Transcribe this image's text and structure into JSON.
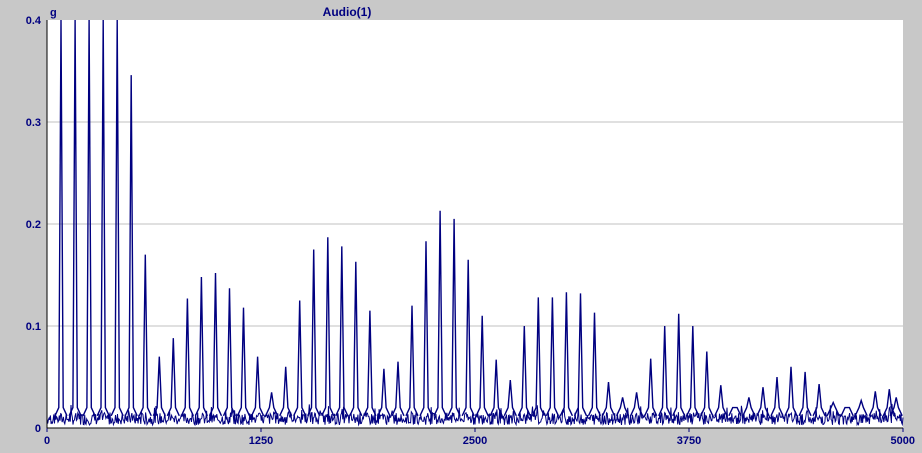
{
  "chart_data": {
    "type": "line",
    "title": "Audio(1)",
    "ylabel": "g",
    "xlabel": "",
    "xlim": [
      0,
      5000
    ],
    "ylim": [
      0,
      0.4
    ],
    "x_ticks": [
      "0",
      "1250",
      "2500",
      "3750",
      "5000"
    ],
    "y_ticks": [
      "0",
      "0.1",
      "0.2",
      "0.3",
      "0.4"
    ],
    "grid": true,
    "colors": {
      "line": "#000080",
      "plot_bg": "#ffffff",
      "frame_bg": "#c8c8c8",
      "grid": "#c0c0c0",
      "text": "#000080"
    },
    "series": [
      {
        "peaks": [
          [
            82,
            0.4
          ],
          [
            164,
            0.4
          ],
          [
            246,
            0.4
          ],
          [
            328,
            0.4
          ],
          [
            410,
            0.4
          ],
          [
            492,
            0.346
          ],
          [
            574,
            0.17
          ],
          [
            656,
            0.07
          ],
          [
            738,
            0.088
          ],
          [
            820,
            0.127
          ],
          [
            902,
            0.148
          ],
          [
            984,
            0.152
          ],
          [
            1066,
            0.137
          ],
          [
            1148,
            0.118
          ],
          [
            1230,
            0.07
          ],
          [
            1312,
            0.035
          ],
          [
            1394,
            0.06
          ],
          [
            1476,
            0.125
          ],
          [
            1558,
            0.175
          ],
          [
            1640,
            0.187
          ],
          [
            1722,
            0.178
          ],
          [
            1804,
            0.163
          ],
          [
            1886,
            0.115
          ],
          [
            1968,
            0.058
          ],
          [
            2050,
            0.065
          ],
          [
            2132,
            0.12
          ],
          [
            2214,
            0.183
          ],
          [
            2296,
            0.213
          ],
          [
            2378,
            0.205
          ],
          [
            2460,
            0.165
          ],
          [
            2542,
            0.11
          ],
          [
            2624,
            0.067
          ],
          [
            2706,
            0.047
          ],
          [
            2788,
            0.1
          ],
          [
            2870,
            0.128
          ],
          [
            2952,
            0.128
          ],
          [
            3034,
            0.133
          ],
          [
            3116,
            0.132
          ],
          [
            3198,
            0.113
          ],
          [
            3280,
            0.045
          ],
          [
            3362,
            0.03
          ],
          [
            3444,
            0.035
          ],
          [
            3526,
            0.068
          ],
          [
            3608,
            0.1
          ],
          [
            3690,
            0.112
          ],
          [
            3772,
            0.1
          ],
          [
            3854,
            0.075
          ],
          [
            3936,
            0.042
          ],
          [
            4018,
            0.02
          ],
          [
            4100,
            0.03
          ],
          [
            4182,
            0.04
          ],
          [
            4264,
            0.05
          ],
          [
            4346,
            0.06
          ],
          [
            4428,
            0.055
          ],
          [
            4510,
            0.043
          ],
          [
            4592,
            0.025
          ],
          [
            4674,
            0.02
          ],
          [
            4756,
            0.027
          ],
          [
            4838,
            0.036
          ],
          [
            4920,
            0.038
          ],
          [
            4960,
            0.03
          ]
        ]
      }
    ]
  }
}
